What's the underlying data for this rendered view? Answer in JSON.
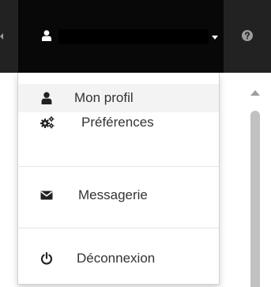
{
  "navbar": {
    "user_icon": "user-icon",
    "caret_icon": "caret-down-icon",
    "help_icon": "question-circle-icon",
    "colors": {
      "background": "#222222",
      "active_toggle": "#080808",
      "icon": "#ffffff"
    }
  },
  "dropdown": {
    "items": [
      {
        "label": "Mon profil",
        "icon": "user-icon"
      },
      {
        "label": "Préférences",
        "icon": "gears-icon"
      },
      {
        "label": "Messagerie",
        "icon": "envelope-icon"
      },
      {
        "label": "Déconnexion",
        "icon": "power-icon"
      }
    ],
    "colors": {
      "text": "#333333",
      "active_item": "#f3f3f3",
      "separator": "#e5e5e5"
    }
  },
  "scrollbar": {
    "thumb_color": "#c1c1c1"
  }
}
